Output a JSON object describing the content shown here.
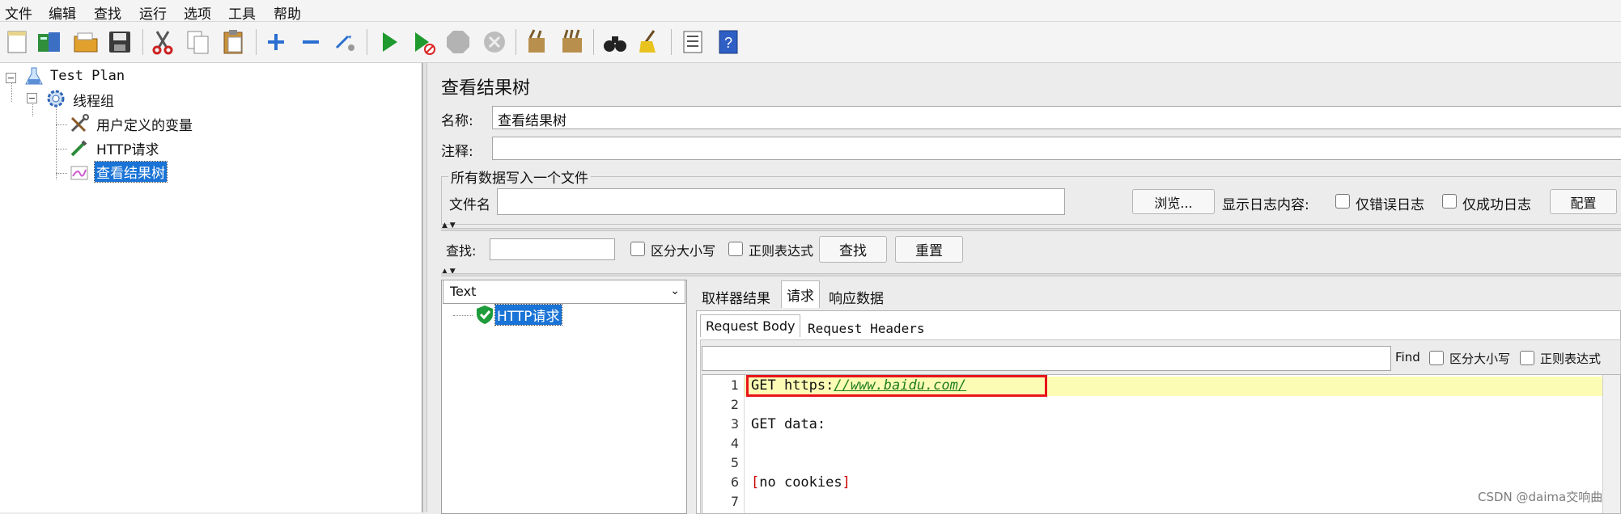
{
  "menu": [
    "文件",
    "编辑",
    "查找",
    "运行",
    "选项",
    "工具",
    "帮助"
  ],
  "toolbar": {
    "icons": [
      "new-icon",
      "templates-icon",
      "open-icon",
      "save-icon",
      "cut-icon",
      "copy-icon",
      "paste-icon",
      "expand-icon",
      "collapse-icon",
      "toggle-icon",
      "start-icon",
      "start-no-pause-icon",
      "stop-icon",
      "shutdown-icon",
      "clear-icon",
      "clear-all-icon",
      "search-icon",
      "reset-search-icon",
      "function-helper-icon",
      "help-icon"
    ]
  },
  "tree": {
    "test_plan": "Test Plan",
    "thread_group": "线程组",
    "user_vars": "用户定义的变量",
    "http_request": "HTTP请求",
    "view_results_tree": "查看结果树"
  },
  "panel": {
    "title": "查看结果树",
    "name_label": "名称:",
    "name_value": "查看结果树",
    "comment_label": "注释:",
    "comment_value": "",
    "file_group_legend": "所有数据写入一个文件",
    "filename_label": "文件名",
    "filename_value": "",
    "browse_button": "浏览...",
    "log_content_label": "显示日志内容:",
    "errors_only": "仅错误日志",
    "success_only": "仅成功日志",
    "configure_button": "配置"
  },
  "search": {
    "label": "查找:",
    "value": "",
    "case_sensitive": "区分大小写",
    "regex": "正则表达式",
    "find_button": "查找",
    "reset_button": "重置"
  },
  "results": {
    "renderer": "Text",
    "sample_item": "HTTP请求",
    "tabs": [
      "取样器结果",
      "请求",
      "响应数据"
    ],
    "subtabs": [
      "Request Body",
      "Request Headers"
    ],
    "find_label": "Find",
    "find_case": "区分大小写",
    "find_regex": "正则表达式",
    "line_numbers": [
      "1",
      "2",
      "3",
      "4",
      "5",
      "6",
      "7"
    ],
    "line1_prefix": "GET https:",
    "line1_url": "//www.baidu.com/",
    "line3": "GET data:",
    "line6_open": "[",
    "line6_text": "no cookies",
    "line6_close": "]"
  },
  "watermark": "CSDN @daima交响曲"
}
